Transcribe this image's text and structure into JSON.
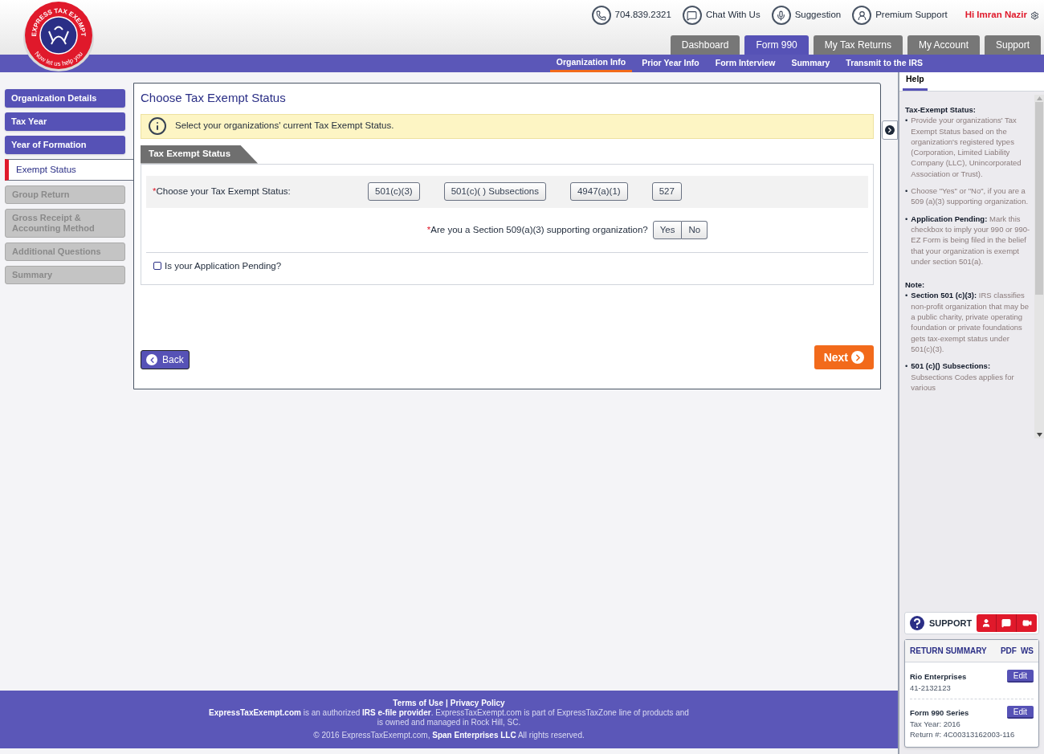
{
  "logo": {
    "title": "EXPRESS TAX EXEMPT",
    "tagline": "Now let us help you"
  },
  "top_links": [
    {
      "kind": "phone",
      "label": "704.839.2321"
    },
    {
      "kind": "chat",
      "label": "Chat With Us"
    },
    {
      "kind": "mic",
      "label": "Suggestion"
    },
    {
      "kind": "agent",
      "label": "Premium Support"
    }
  ],
  "user": {
    "greeting": "Hi Imran Nazir"
  },
  "main_tabs": [
    {
      "label": "Dashboard",
      "selected": false
    },
    {
      "label": "Form 990",
      "selected": true
    },
    {
      "label": "My Tax Returns",
      "selected": false
    },
    {
      "label": "My Account",
      "selected": false
    },
    {
      "label": "Support",
      "selected": false
    }
  ],
  "sub_nav": [
    {
      "label": "Organization Info",
      "selected": true
    },
    {
      "label": "Prior Year Info",
      "selected": false
    },
    {
      "label": "Form Interview",
      "selected": false
    },
    {
      "label": "Summary",
      "selected": false
    },
    {
      "label": "Transmit to the IRS",
      "selected": false
    }
  ],
  "sidebar": {
    "items": [
      {
        "label": "Organization Details",
        "kind": "done"
      },
      {
        "label": "Tax Year",
        "kind": "done"
      },
      {
        "label": "Year of Formation",
        "kind": "done"
      },
      {
        "label": "Exempt Status",
        "kind": "current"
      },
      {
        "label": "Group Return",
        "kind": "pending"
      },
      {
        "label": "Gross Receipt & Accounting Method",
        "kind": "pending"
      },
      {
        "label": "Additional Questions",
        "kind": "pending"
      },
      {
        "label": "Summary",
        "kind": "pending"
      }
    ]
  },
  "panel": {
    "title": "Choose Tax Exempt Status",
    "info": "Select your organizations' current Tax Exempt Status.",
    "section_tab": "Tax Exempt Status",
    "status_question": {
      "required_mark": "*",
      "label": "Choose your Tax Exempt Status:",
      "options": [
        {
          "label": "501(c)(3)",
          "selected": false
        },
        {
          "label": "501(c)( ) Subsections",
          "selected": false
        },
        {
          "label": "4947(a)(1)",
          "selected": false
        },
        {
          "label": "527",
          "selected": false
        }
      ]
    },
    "support_question": {
      "required_mark": "*",
      "label": "Are you a Section 509(a)(3) supporting organization?",
      "options": [
        {
          "label": "Yes",
          "selected": false
        },
        {
          "label": "No",
          "selected": false
        }
      ]
    },
    "pending": {
      "label": "Is your Application Pending?",
      "checked": false
    },
    "back": "Back",
    "next": "Next"
  },
  "help": {
    "tab": "Help",
    "bullet": "•",
    "sections": [
      {
        "heading": "Tax-Exempt Status:",
        "items": [
          "Provide your organizations' Tax Exempt Status based on the organization's registered types (Corporation, Limited Liability Company (LLC), Unincorporated Association or Trust).",
          "Choose \"Yes\" or \"No\", if you are a 509 (a)(3) supporting organization.",
          "**Application Pending:** Mark this checkbox to imply your 990 or 990-EZ Form is being filed in the belief that your organization is exempt under section 501(a)."
        ]
      },
      {
        "heading": "Note:",
        "items": [
          "**Section 501 (c)(3):** IRS classifies non-profit organization that may be a public charity, private operating foundation or private foundations gets tax-exempt status under 501(c)(3).",
          "**501 (c)() Subsections:** Subsections Codes applies for various"
        ]
      }
    ]
  },
  "support": {
    "label": "SUPPORT"
  },
  "return_summary": {
    "title": "RETURN SUMMARY",
    "links": [
      "PDF",
      "WS"
    ],
    "entries": [
      {
        "name": "Rio Enterprises",
        "lines": [
          "41-2132123"
        ],
        "action": "Edit"
      },
      {
        "name": "Form 990 Series",
        "lines": [
          "Tax Year: 2016",
          "Return #: 4C00313162003-116"
        ],
        "action": "Edit"
      }
    ]
  },
  "footer": {
    "links": [
      "Terms of Use",
      "Privacy Policy"
    ],
    "separator": "|",
    "text": "**ExpressTaxExempt.com** is an authorized **IRS e-file provider**. ExpressTaxExempt.com is part of ExpressTaxZone line of products and is owned and managed in Rock Hill, SC.",
    "copyright": "© 2016 ExpressTaxExempt.com, **Span Enterprises LLC** All rights reserved."
  }
}
